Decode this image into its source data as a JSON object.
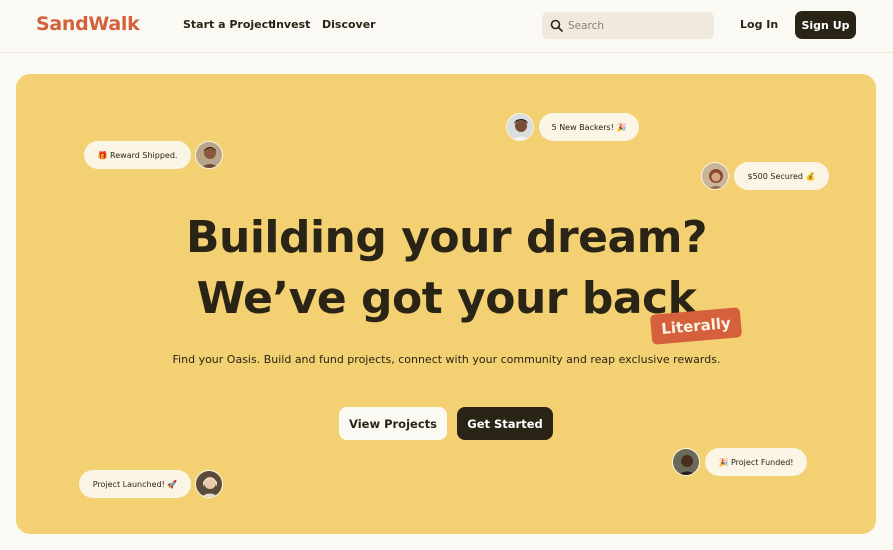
{
  "brand": {
    "logo": "SandWalk"
  },
  "nav": {
    "links": [
      "Start a Project",
      "Invest",
      "Discover"
    ],
    "search_placeholder": "Search",
    "login": "Log In",
    "signup": "Sign Up"
  },
  "hero": {
    "headline_line1": "Building your dream?",
    "headline_line2": "We’ve got your back",
    "highlight": "Literally",
    "subtitle": "Find your Oasis. Build and fund projects, connect with your community and reap exclusive rewards.",
    "primary_button": "View Projects",
    "secondary_button": "Get Started"
  },
  "notifications": [
    {
      "text": "🎁 Reward Shipped."
    },
    {
      "text": "5 New Backers! 🎉"
    },
    {
      "text": "$500 Secured 💰"
    },
    {
      "text": "🎉 Project Funded!"
    },
    {
      "text": "Project Launched! 🚀"
    }
  ],
  "colors": {
    "accent": "#d4613c",
    "hero_bg": "#f3d172",
    "dark": "#2a2416",
    "page_bg": "#fbf9f4"
  }
}
